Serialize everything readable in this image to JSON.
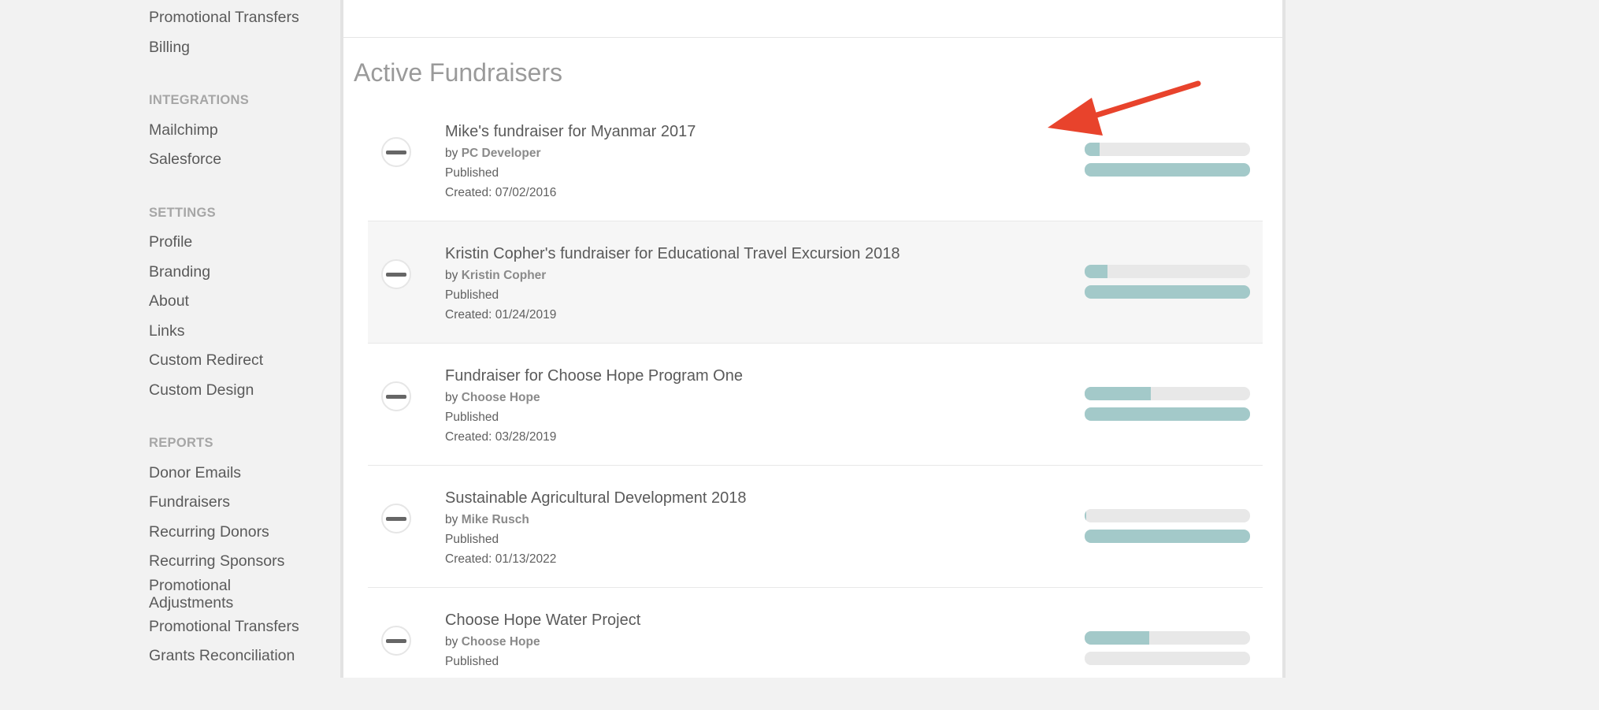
{
  "sidebar": {
    "items_top": [
      "Promotional Transfers",
      "Billing"
    ],
    "integrations_heading": "INTEGRATIONS",
    "integrations": [
      "Mailchimp",
      "Salesforce"
    ],
    "settings_heading": "SETTINGS",
    "settings": [
      "Profile",
      "Branding",
      "About",
      "Links",
      "Custom Redirect",
      "Custom Design"
    ],
    "reports_heading": "REPORTS",
    "reports": [
      "Donor Emails",
      "Fundraisers",
      "Recurring Donors",
      "Recurring Sponsors",
      "Promotional Adjustments",
      "Promotional Transfers",
      "Grants Reconciliation"
    ]
  },
  "main": {
    "section_title": "Active Fundraisers",
    "by_prefix": "by",
    "fundraisers": [
      {
        "title": "Mike's fundraiser for Myanmar 2017",
        "author": "PC Developer",
        "status": "Published",
        "created": "Created: 07/02/2016",
        "progress": 0.09,
        "secondary": 1.0
      },
      {
        "title": "Kristin Copher's fundraiser for Educational Travel Excursion 2018",
        "author": "Kristin Copher",
        "status": "Published",
        "created": "Created: 01/24/2019",
        "progress": 0.14,
        "secondary": 1.0
      },
      {
        "title": "Fundraiser for Choose Hope Program One",
        "author": "Choose Hope",
        "status": "Published",
        "created": "Created: 03/28/2019",
        "progress": 0.4,
        "secondary": 1.0
      },
      {
        "title": "Sustainable Agricultural Development 2018",
        "author": "Mike Rusch",
        "status": "Published",
        "created": "Created: 01/13/2022",
        "progress": 0.01,
        "secondary": 1.0
      },
      {
        "title": "Choose Hope Water Project",
        "author": "Choose Hope",
        "status": "Published",
        "created": "",
        "progress": 0.39,
        "secondary": 0.0
      }
    ]
  },
  "colors": {
    "accent_bar": "#a3c9c9",
    "bar_track": "#e8e8e8",
    "arrow": "#e8432c"
  }
}
